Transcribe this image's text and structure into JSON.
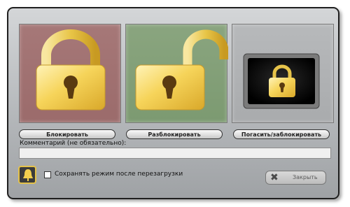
{
  "panels": {
    "lock": {
      "icon": "locked-padlock-icon"
    },
    "unlock": {
      "icon": "unlocked-padlock-icon"
    },
    "screen": {
      "icon": "screen-off-lock-icon"
    }
  },
  "buttons": {
    "lock": "Блокировать",
    "unlock": "Разблокировать",
    "screen_off_lock": "Погасить/заблокировать"
  },
  "comment": {
    "label": "Комментарий (не обязательно):",
    "value": ""
  },
  "persist": {
    "label": "Сохранять режим после перезагрузки",
    "checked": false
  },
  "close": {
    "label": "Закрыть",
    "icon": "close-x-icon"
  },
  "bell": {
    "icon": "bell-icon"
  },
  "colors": {
    "lock_panel": "#a67878",
    "unlock_panel": "#8aa57f",
    "screen_panel": "#b7b9bb",
    "gold": "#f3cf4e"
  }
}
